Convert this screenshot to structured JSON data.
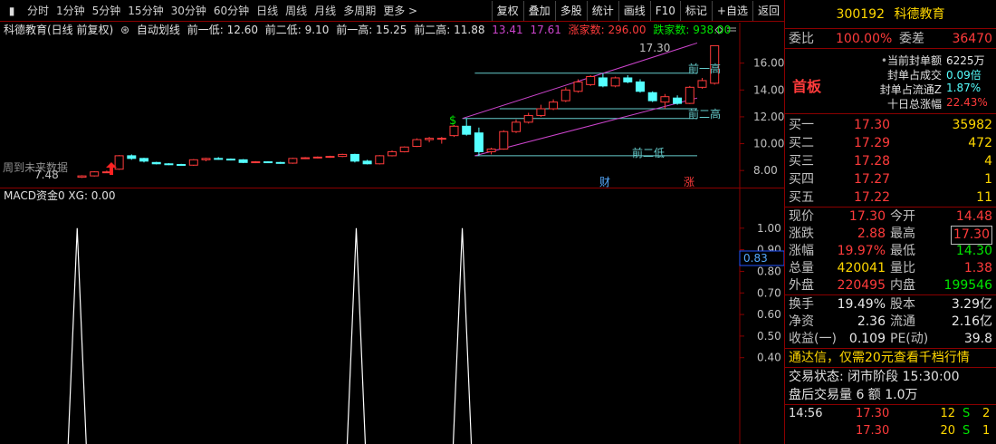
{
  "toolbar": {
    "first": "",
    "periods": [
      "分时",
      "1分钟",
      "5分钟",
      "15分钟",
      "30分钟",
      "60分钟",
      "日线",
      "周线",
      "月线",
      "多周期",
      "更多 >"
    ],
    "right_buttons": [
      "复权",
      "叠加",
      "多股",
      "统计",
      "画线",
      "F10",
      "标记",
      "+自选",
      "返回"
    ]
  },
  "main_chart": {
    "info": {
      "name": "科德教育(日线 前复权)",
      "indicator": "自动划线",
      "low1": "前一低: 12.60",
      "low2": "前二低: 9.10",
      "high1": "前一高: 15.25",
      "high2": "前二高: 11.88",
      "v1": "13.41",
      "v2": "17.61",
      "up_count": "涨家数: 296.00",
      "down_count": "跌家数: 938.00"
    },
    "labels": {
      "high1": "前一高",
      "high2": "前二高",
      "low2": "前二低",
      "peak": "17.30",
      "bottom": "7.48",
      "future": "周到未来数据",
      "cai": "财",
      "zhang": "涨",
      "dollar": "$"
    },
    "y_ticks": [
      "16.00",
      "14.00",
      "12.00",
      "10.00",
      "8.00"
    ]
  },
  "chart_data": [
    {
      "type": "candlestick",
      "ylim": [
        7,
        17.8
      ],
      "candles": [
        {
          "o": 7.5,
          "c": 7.6,
          "h": 7.65,
          "l": 7.45
        },
        {
          "o": 7.6,
          "c": 7.9,
          "h": 7.95,
          "l": 7.55
        },
        {
          "o": 7.9,
          "c": 7.9,
          "h": 8.0,
          "l": 7.85
        },
        {
          "o": 8.1,
          "c": 9.1,
          "h": 9.15,
          "l": 8.05
        },
        {
          "o": 9.1,
          "c": 8.9,
          "h": 9.2,
          "l": 8.8
        },
        {
          "o": 8.9,
          "c": 8.7,
          "h": 8.95,
          "l": 8.6
        },
        {
          "o": 8.6,
          "c": 8.5,
          "h": 8.65,
          "l": 8.45
        },
        {
          "o": 8.5,
          "c": 8.45,
          "h": 8.55,
          "l": 8.4
        },
        {
          "o": 8.45,
          "c": 8.4,
          "h": 8.5,
          "l": 8.35
        },
        {
          "o": 8.4,
          "c": 8.8,
          "h": 8.85,
          "l": 8.35
        },
        {
          "o": 8.8,
          "c": 8.9,
          "h": 8.95,
          "l": 8.7
        },
        {
          "o": 8.9,
          "c": 8.85,
          "h": 9.0,
          "l": 8.8
        },
        {
          "o": 8.85,
          "c": 8.8,
          "h": 8.9,
          "l": 8.75
        },
        {
          "o": 8.8,
          "c": 8.6,
          "h": 8.85,
          "l": 8.55
        },
        {
          "o": 8.6,
          "c": 8.65,
          "h": 8.7,
          "l": 8.55
        },
        {
          "o": 8.65,
          "c": 8.6,
          "h": 8.7,
          "l": 8.55
        },
        {
          "o": 8.6,
          "c": 8.55,
          "h": 8.65,
          "l": 8.5
        },
        {
          "o": 8.55,
          "c": 8.9,
          "h": 8.95,
          "l": 8.5
        },
        {
          "o": 8.9,
          "c": 8.95,
          "h": 9.0,
          "l": 8.85
        },
        {
          "o": 8.95,
          "c": 9.0,
          "h": 9.05,
          "l": 8.9
        },
        {
          "o": 9.0,
          "c": 9.05,
          "h": 9.1,
          "l": 8.95
        },
        {
          "o": 9.05,
          "c": 9.2,
          "h": 9.25,
          "l": 9.0
        },
        {
          "o": 9.2,
          "c": 8.7,
          "h": 9.25,
          "l": 8.6
        },
        {
          "o": 8.7,
          "c": 8.5,
          "h": 8.8,
          "l": 8.45
        },
        {
          "o": 8.5,
          "c": 9.1,
          "h": 9.15,
          "l": 8.45
        },
        {
          "o": 9.1,
          "c": 9.4,
          "h": 9.5,
          "l": 9.05
        },
        {
          "o": 9.4,
          "c": 9.75,
          "h": 9.8,
          "l": 9.35
        },
        {
          "o": 9.8,
          "c": 10.3,
          "h": 10.4,
          "l": 9.75
        },
        {
          "o": 10.3,
          "c": 10.4,
          "h": 10.5,
          "l": 10.1
        },
        {
          "o": 10.4,
          "c": 10.4,
          "h": 10.5,
          "l": 10.0
        },
        {
          "o": 10.6,
          "c": 11.3,
          "h": 11.4,
          "l": 10.5
        },
        {
          "o": 11.3,
          "c": 10.7,
          "h": 11.88,
          "l": 10.6
        },
        {
          "o": 10.8,
          "c": 9.4,
          "h": 11.2,
          "l": 9.1
        },
        {
          "o": 9.4,
          "c": 9.6,
          "h": 9.7,
          "l": 9.2
        },
        {
          "o": 9.6,
          "c": 10.9,
          "h": 11.0,
          "l": 9.55
        },
        {
          "o": 10.9,
          "c": 11.6,
          "h": 11.8,
          "l": 10.8
        },
        {
          "o": 11.6,
          "c": 12.1,
          "h": 12.3,
          "l": 11.5
        },
        {
          "o": 12.1,
          "c": 12.6,
          "h": 12.9,
          "l": 12.0
        },
        {
          "o": 12.6,
          "c": 13.1,
          "h": 13.3,
          "l": 12.5
        },
        {
          "o": 13.2,
          "c": 14.0,
          "h": 14.2,
          "l": 13.1
        },
        {
          "o": 13.9,
          "c": 14.6,
          "h": 14.8,
          "l": 13.8
        },
        {
          "o": 14.4,
          "c": 15.0,
          "h": 15.1,
          "l": 14.3
        },
        {
          "o": 14.9,
          "c": 14.3,
          "h": 15.25,
          "l": 14.2
        },
        {
          "o": 14.3,
          "c": 14.9,
          "h": 15.0,
          "l": 14.2
        },
        {
          "o": 14.9,
          "c": 14.6,
          "h": 15.1,
          "l": 14.5
        },
        {
          "o": 14.6,
          "c": 13.9,
          "h": 14.8,
          "l": 13.8
        },
        {
          "o": 13.8,
          "c": 13.2,
          "h": 13.9,
          "l": 13.1
        },
        {
          "o": 13.1,
          "c": 13.5,
          "h": 13.7,
          "l": 12.6
        },
        {
          "o": 13.4,
          "c": 13.0,
          "h": 13.6,
          "l": 12.9
        },
        {
          "o": 13.0,
          "c": 14.2,
          "h": 14.3,
          "l": 12.95
        },
        {
          "o": 14.2,
          "c": 14.7,
          "h": 14.9,
          "l": 14.1
        },
        {
          "o": 14.5,
          "c": 17.3,
          "h": 17.3,
          "l": 14.4
        }
      ]
    },
    {
      "type": "line",
      "title": "MACD资金0 XG: 0.00",
      "ylim": [
        0,
        1.1
      ],
      "values": [
        0,
        0,
        0,
        0,
        0,
        0,
        0,
        0,
        0,
        0,
        0,
        0,
        0,
        0,
        0,
        0,
        0,
        0,
        0,
        0,
        0,
        0,
        0,
        0,
        0,
        0,
        0,
        0,
        0,
        0,
        0,
        0,
        0,
        0,
        0,
        0,
        0,
        0,
        0,
        0,
        0,
        0,
        0,
        0,
        0,
        0,
        0,
        0,
        0,
        0,
        0,
        0,
        0,
        0,
        0,
        0,
        0,
        0,
        0,
        0,
        0,
        0,
        0,
        0,
        0,
        0,
        0,
        0,
        0,
        0,
        0,
        0,
        0,
        0,
        0,
        0,
        0,
        0,
        0,
        0,
        0,
        0,
        0,
        0,
        0,
        0,
        0,
        0,
        0,
        0,
        0,
        1,
        0,
        0,
        0,
        0,
        0,
        0,
        0,
        0,
        0,
        0,
        0,
        0,
        0,
        0,
        0,
        0,
        0,
        0,
        0,
        0,
        0,
        0,
        0,
        0,
        0,
        0,
        0,
        0,
        0,
        0,
        0,
        0,
        0,
        0,
        0,
        0,
        0,
        0,
        0,
        0,
        0,
        0,
        0,
        0,
        0,
        0,
        0,
        0,
        0,
        0,
        0,
        0,
        0,
        0,
        0,
        0,
        0,
        0,
        0,
        0,
        0,
        0,
        0,
        0,
        0,
        0,
        0,
        0,
        0,
        0,
        0,
        0,
        0,
        0,
        0,
        0,
        0,
        0,
        0,
        0,
        0,
        0,
        0,
        0,
        0,
        0,
        0,
        0,
        0,
        0,
        0,
        0,
        0,
        0,
        0,
        0,
        0,
        0,
        0,
        0,
        0,
        0,
        0,
        0,
        0,
        0,
        0,
        0,
        0,
        0,
        0,
        0,
        0,
        0,
        0,
        0,
        0,
        0,
        0,
        0,
        0,
        0,
        0,
        0,
        0,
        0,
        0,
        0,
        0,
        0,
        0,
        0,
        0,
        0,
        0,
        0,
        0,
        0,
        0,
        0,
        0,
        0,
        0,
        0,
        0,
        0,
        0,
        0,
        0,
        0,
        0,
        0,
        0,
        0,
        0,
        0,
        0,
        0,
        0,
        0,
        0,
        0,
        0,
        0,
        0,
        0,
        0,
        0,
        0,
        0,
        0,
        0,
        0,
        0,
        0,
        0,
        0,
        0,
        0,
        0,
        0,
        0,
        0,
        0,
        0,
        0,
        0,
        0,
        0,
        0,
        0,
        0,
        0,
        0,
        0,
        0,
        0,
        0,
        0,
        0,
        0,
        0,
        0,
        0,
        0,
        0,
        0,
        0,
        0,
        0,
        0,
        0,
        0,
        0,
        0,
        0,
        0,
        0,
        0,
        0,
        0,
        0,
        0,
        0,
        0,
        0,
        0,
        0,
        0,
        0,
        0,
        0,
        0,
        0,
        0,
        0,
        0,
        0,
        0,
        0,
        0,
        0,
        0,
        0,
        0,
        0,
        0,
        0,
        0,
        0,
        0,
        0,
        0,
        0,
        0,
        0,
        0,
        0,
        0,
        0,
        0,
        0,
        0,
        0,
        0,
        0,
        0,
        0,
        0,
        0,
        0,
        0,
        0,
        0,
        0,
        0,
        0,
        0,
        0,
        0,
        0,
        0,
        0,
        0,
        0,
        0,
        0,
        0,
        0,
        0,
        0,
        0,
        0,
        0,
        0,
        0,
        0,
        0,
        0,
        0,
        0,
        0,
        0,
        0,
        0,
        0,
        0,
        0,
        0,
        0,
        0,
        0,
        0,
        0,
        0,
        0,
        0,
        0,
        0,
        0,
        0,
        0,
        0,
        0,
        0,
        0,
        0,
        0,
        1,
        0,
        0,
        0,
        0,
        0,
        0,
        0,
        0,
        0,
        0,
        0,
        0,
        0,
        0,
        0,
        0,
        0,
        0,
        0,
        0,
        0,
        0,
        0,
        0,
        0,
        0,
        0,
        0,
        0,
        0,
        0,
        0,
        0,
        0,
        0,
        0,
        0,
        0,
        0,
        0,
        0,
        0,
        0,
        0,
        0,
        0,
        0,
        0,
        0,
        0,
        0,
        0,
        0,
        0,
        0,
        0,
        0,
        0,
        0,
        0,
        0,
        0,
        0,
        0,
        0,
        0,
        0,
        0,
        0,
        0,
        0,
        0,
        0,
        0,
        0,
        0,
        0,
        0,
        0,
        0,
        0,
        0,
        0,
        0,
        0,
        0,
        0,
        0,
        0,
        0,
        0,
        0,
        0,
        0,
        0,
        0,
        0,
        0,
        0,
        0,
        0,
        0,
        0,
        0,
        0,
        0,
        0,
        0,
        0,
        0,
        0,
        0,
        0,
        0,
        0,
        0,
        0,
        0,
        0,
        0,
        0,
        0,
        0,
        0,
        1,
        0,
        0,
        0,
        0,
        0,
        0,
        0,
        0,
        0,
        0,
        0,
        0,
        0,
        0,
        0,
        0,
        0,
        0,
        0,
        0,
        0,
        0,
        0,
        0,
        0,
        0,
        0,
        0,
        0,
        0,
        0,
        0,
        0,
        0,
        0,
        0,
        0,
        0,
        0,
        0,
        0,
        0,
        0,
        0,
        0,
        0,
        0,
        0,
        0,
        0,
        0,
        0,
        0,
        0,
        0,
        0,
        0,
        0,
        0,
        0,
        0,
        0,
        0,
        0,
        0,
        0,
        0,
        0,
        0,
        0,
        0,
        0,
        0,
        0,
        0,
        0,
        0,
        0,
        0,
        0,
        0,
        0,
        0,
        0,
        0,
        0,
        0,
        0,
        0,
        0,
        0,
        0,
        0,
        0,
        0,
        0,
        0,
        0,
        0,
        0,
        0,
        0,
        0,
        0,
        0,
        0,
        0,
        0,
        0,
        0,
        0,
        0,
        0,
        0,
        0,
        0,
        0,
        0,
        0,
        0,
        0,
        0,
        0,
        0,
        0,
        0,
        0,
        0,
        0,
        0,
        0,
        0,
        0,
        0,
        0,
        0,
        0,
        0,
        0,
        0,
        0,
        0,
        0,
        0,
        0,
        0,
        0,
        0,
        0,
        0,
        0,
        0,
        0,
        0,
        0,
        0,
        0,
        0,
        0,
        0,
        0,
        0,
        0,
        0,
        0,
        0,
        0,
        0,
        0,
        0,
        0,
        0,
        0,
        0,
        0,
        0,
        0,
        0,
        0,
        0,
        0,
        0,
        0,
        0,
        0,
        0,
        0,
        0,
        0,
        0,
        0,
        0,
        0,
        0,
        0,
        0,
        0,
        0,
        0,
        0,
        0,
        0,
        0,
        0,
        0,
        0,
        0,
        0,
        0,
        0,
        0,
        0,
        0,
        0,
        0,
        0,
        0,
        0,
        0,
        0,
        0,
        0,
        0,
        0,
        0,
        0,
        0,
        0,
        0,
        0,
        0,
        0,
        0,
        0,
        0,
        0,
        0,
        0,
        0,
        0,
        0,
        0,
        0,
        0,
        0,
        0,
        0,
        0,
        0,
        0,
        0,
        0,
        0,
        0,
        0,
        0,
        0,
        0,
        0,
        0,
        0,
        0,
        0,
        0,
        0,
        0,
        0,
        0,
        0,
        0,
        0,
        0,
        0,
        0,
        0,
        0,
        0,
        0,
        0,
        0,
        0,
        0,
        0,
        0,
        0,
        0,
        0,
        0,
        0,
        0,
        0,
        0,
        0,
        0,
        0,
        0,
        0,
        0,
        0,
        0,
        0,
        0,
        0,
        0,
        0,
        0,
        0,
        0,
        0,
        0,
        0,
        0,
        0,
        0,
        0,
        0,
        0,
        0,
        0,
        0,
        0,
        0,
        0,
        0,
        0
      ],
      "y_ticks": [
        "1.00",
        "0.90",
        "0.80",
        "0.70",
        "0.60",
        "0.50",
        "0.40"
      ],
      "cursor_value": "0.83"
    }
  ],
  "right": {
    "code": "300192",
    "name": "科德教育",
    "wei_bi_label": "委比",
    "wei_bi": "100.00%",
    "wei_cha_label": "委差",
    "wei_cha": "36470",
    "seal": {
      "badge": "首板",
      "rows": [
        {
          "label": "当前封单额",
          "value": "6225万",
          "cls": "white"
        },
        {
          "label": "封单占成交",
          "value": "0.09倍",
          "cls": "cyan"
        },
        {
          "label": "封单占流通Z",
          "value": "1.87%",
          "cls": "cyan"
        },
        {
          "label": "十日总涨幅",
          "value": "22.43%",
          "cls": "red"
        }
      ]
    },
    "book": [
      {
        "label": "买一",
        "price": "17.30",
        "vol": "35982",
        "cls": "yellow"
      },
      {
        "label": "买二",
        "price": "17.29",
        "vol": "472",
        "cls": "yellow"
      },
      {
        "label": "买三",
        "price": "17.28",
        "vol": "4",
        "cls": "yellow"
      },
      {
        "label": "买四",
        "price": "17.27",
        "vol": "1",
        "cls": "yellow"
      },
      {
        "label": "买五",
        "price": "17.22",
        "vol": "11",
        "cls": "yellow"
      }
    ],
    "quote": [
      {
        "l1": "现价",
        "v1": "17.30",
        "c1": "red",
        "l2": "今开",
        "v2": "14.48",
        "c2": "red"
      },
      {
        "l1": "涨跌",
        "v1": "2.88",
        "c1": "red",
        "l2": "最高",
        "v2": "17.30",
        "c2": "red",
        "boxed": true
      },
      {
        "l1": "涨幅",
        "v1": "19.97%",
        "c1": "red",
        "l2": "最低",
        "v2": "14.30",
        "c2": "green"
      },
      {
        "l1": "总量",
        "v1": "420041",
        "c1": "yellow",
        "l2": "量比",
        "v2": "1.38",
        "c2": "red"
      },
      {
        "l1": "外盘",
        "v1": "220495",
        "c1": "red",
        "l2": "内盘",
        "v2": "199546",
        "c2": "green"
      }
    ],
    "quote2": [
      {
        "l1": "换手",
        "v1": "19.49%",
        "c1": "white",
        "l2": "股本",
        "v2": "3.29亿",
        "c2": "white"
      },
      {
        "l1": "净资",
        "v1": "2.36",
        "c1": "white",
        "l2": "流通",
        "v2": "2.16亿",
        "c2": "white"
      },
      {
        "l1": "收益(一)",
        "v1": "0.109",
        "c1": "white",
        "l2": "PE(动)",
        "v2": "39.8",
        "c2": "white"
      }
    ],
    "promo": "通达信，仅需20元查看千档行情",
    "status": "交易状态: 闭市阶段 15:30:00",
    "after_hours": "盘后交易量 6 额 1.0万",
    "trades": [
      {
        "time": "14:56",
        "price": "17.30",
        "vol": "12",
        "side": "S",
        "side_cls": "green",
        "n": "2"
      },
      {
        "time": "",
        "price": "17.30",
        "vol": "20",
        "side": "S",
        "side_cls": "green",
        "n": "1"
      }
    ]
  },
  "colors": {
    "up": "#ff3b3b",
    "down": "#55ffff",
    "grid": "#8b0000",
    "channel": "#cc44cc",
    "level": "#66cccc"
  }
}
